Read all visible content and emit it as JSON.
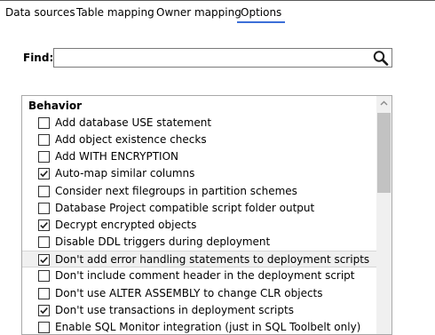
{
  "tabs": [
    {
      "label": "Data sources"
    },
    {
      "label": "Table mapping"
    },
    {
      "label": "Owner mapping"
    },
    {
      "label": "Options"
    }
  ],
  "active_tab": "Options",
  "find": {
    "label": "Find:",
    "value": "",
    "search_icon": "magnifier-icon"
  },
  "behavior": {
    "title": "Behavior",
    "options": [
      {
        "label": "Add database USE statement",
        "checked": false
      },
      {
        "label": "Add object existence checks",
        "checked": false
      },
      {
        "label": "Add WITH ENCRYPTION",
        "checked": false
      },
      {
        "label": "Auto-map similar columns",
        "checked": true
      },
      {
        "label": "Consider next filegroups in partition schemes",
        "checked": false
      },
      {
        "label": "Database Project compatible script folder output",
        "checked": false
      },
      {
        "label": "Decrypt encrypted objects",
        "checked": true
      },
      {
        "label": "Disable DDL triggers during deployment",
        "checked": false
      },
      {
        "label": "Don't add error handling statements to deployment scripts",
        "checked": true
      },
      {
        "label": "Don't include comment header in the deployment script",
        "checked": false
      },
      {
        "label": "Don't use ALTER ASSEMBLY to change CLR objects",
        "checked": false
      },
      {
        "label": "Don't use transactions in deployment scripts",
        "checked": true
      },
      {
        "label": "Enable SQL Monitor integration (just in SQL Toolbelt only)",
        "checked": false
      }
    ]
  },
  "colors": {
    "tab_underline": "#3c6fd8",
    "row_highlight": "#f0f0f0",
    "scroll_thumb": "#c2c2c2"
  }
}
